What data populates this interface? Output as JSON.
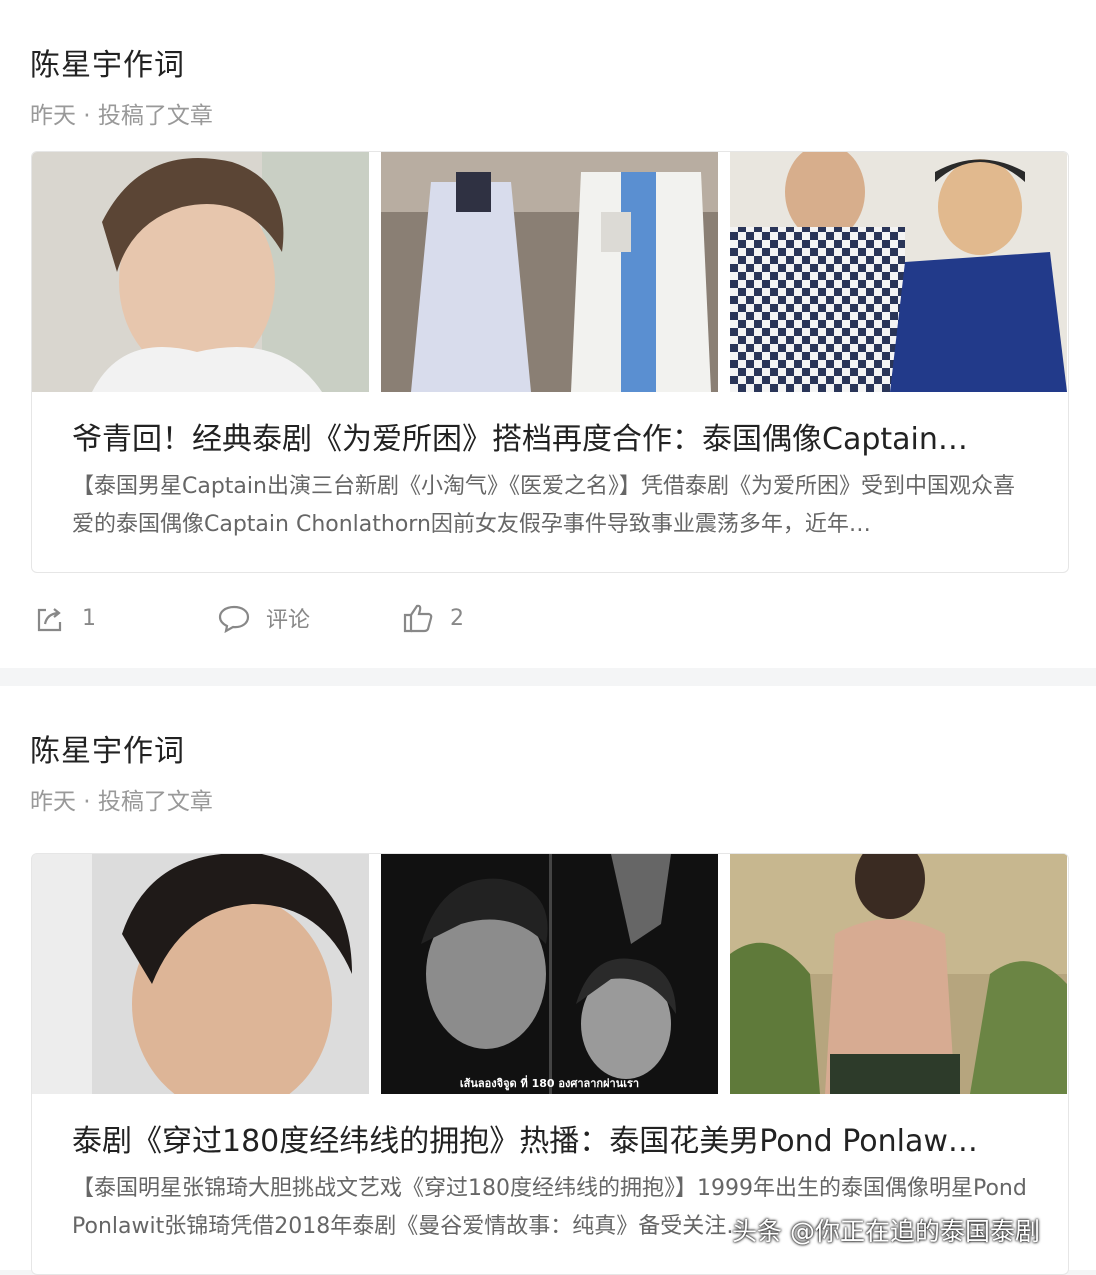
{
  "posts": [
    {
      "author": "陈星宇作词",
      "meta": "昨天 · 投稿了文章",
      "title": "爷青回！经典泰剧《为爱所困》搭档再度合作：泰国偶像Captain…",
      "description": "【泰国男星Captain出演三台新剧《小淘气》《医爱之名》】凭借泰剧《为爱所困》受到中国观众喜爱的泰国偶像Captain Chonlathorn因前女友假孕事件导致事业震荡多年，近年…",
      "images": [
        "portrait-photo",
        "doctors-walking-photo",
        "two-men-photo"
      ],
      "actions": {
        "share_count": "1",
        "comment_label": "评论",
        "like_count": "2"
      }
    },
    {
      "author": "陈星宇作词",
      "meta": "昨天 · 投稿了文章",
      "title": "泰剧《穿过180度经纬线的拥抱》热播：泰国花美男Pond Ponlaw…",
      "description": "【泰国明星张锦琦大胆挑战文艺戏《穿过180度经纬线的拥抱》】1999年出生的泰国偶像明星Pond Ponlawit张锦琦凭借2018年泰剧《曼谷爱情故事：纯真》备受关注…",
      "images": [
        "portrait-closeup-photo",
        "drama-poster",
        "shirtless-man-photo"
      ],
      "poster_text": "เส้นลองจิจูด ที่ 180 องศาลากผ่านเรา"
    }
  ],
  "watermark": "头条 @你正在追的泰国泰剧"
}
